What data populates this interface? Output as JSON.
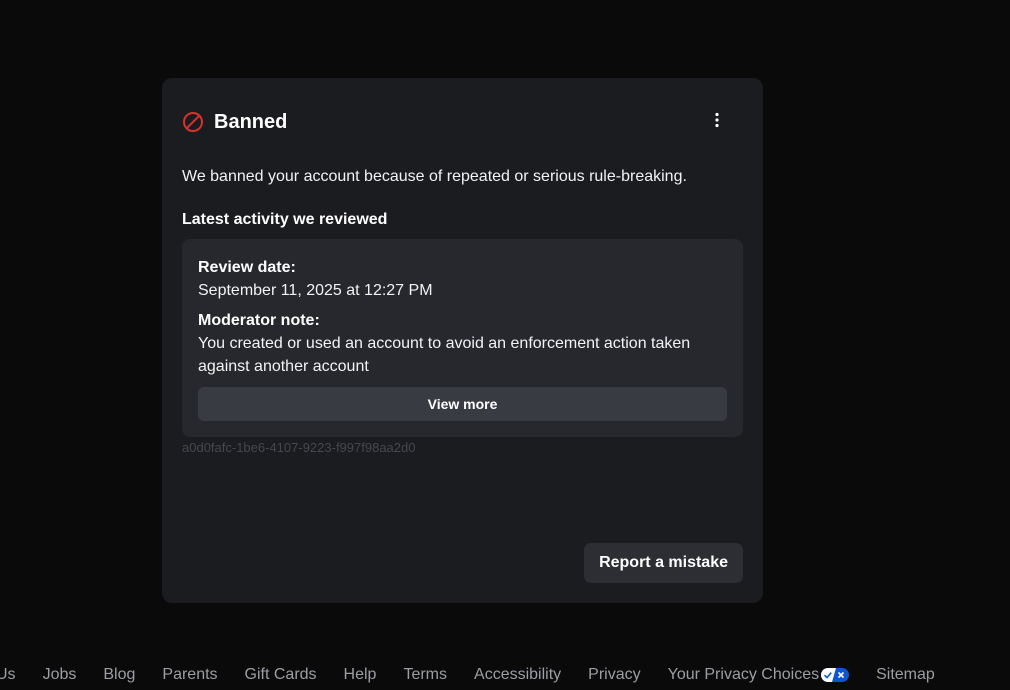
{
  "card": {
    "title": "Banned",
    "icon": "ban-icon",
    "menu_icon": "more-vertical-icon",
    "description": "We banned your account because of repeated or serious rule-breaking.",
    "section_heading": "Latest activity we reviewed",
    "activity": {
      "review_date_label": "Review date:",
      "review_date_value": "September 11, 2025 at 12:27 PM",
      "moderator_note_label": "Moderator note:",
      "moderator_note_line1": "You created or used an account to avoid an enforcement action taken",
      "moderator_note_line2": "against another account",
      "view_more_label": "View more"
    },
    "reference_id": "a0d0fafc-1be6-4107-9223-f997f98aa2d0",
    "report_button_label": "Report a mistake"
  },
  "footer": {
    "links": [
      "Us",
      "Jobs",
      "Blog",
      "Parents",
      "Gift Cards",
      "Help",
      "Terms",
      "Accessibility",
      "Privacy",
      "Your Privacy Choices",
      "Sitemap"
    ],
    "privacy_choices_icon": "privacy-toggle-icon"
  },
  "colors": {
    "background": "#0a0a0b",
    "card": "#1b1c20",
    "panel": "#26282e",
    "ban_red": "#d6312c",
    "button": "#393b42",
    "footer_text": "#9b9ea3"
  }
}
